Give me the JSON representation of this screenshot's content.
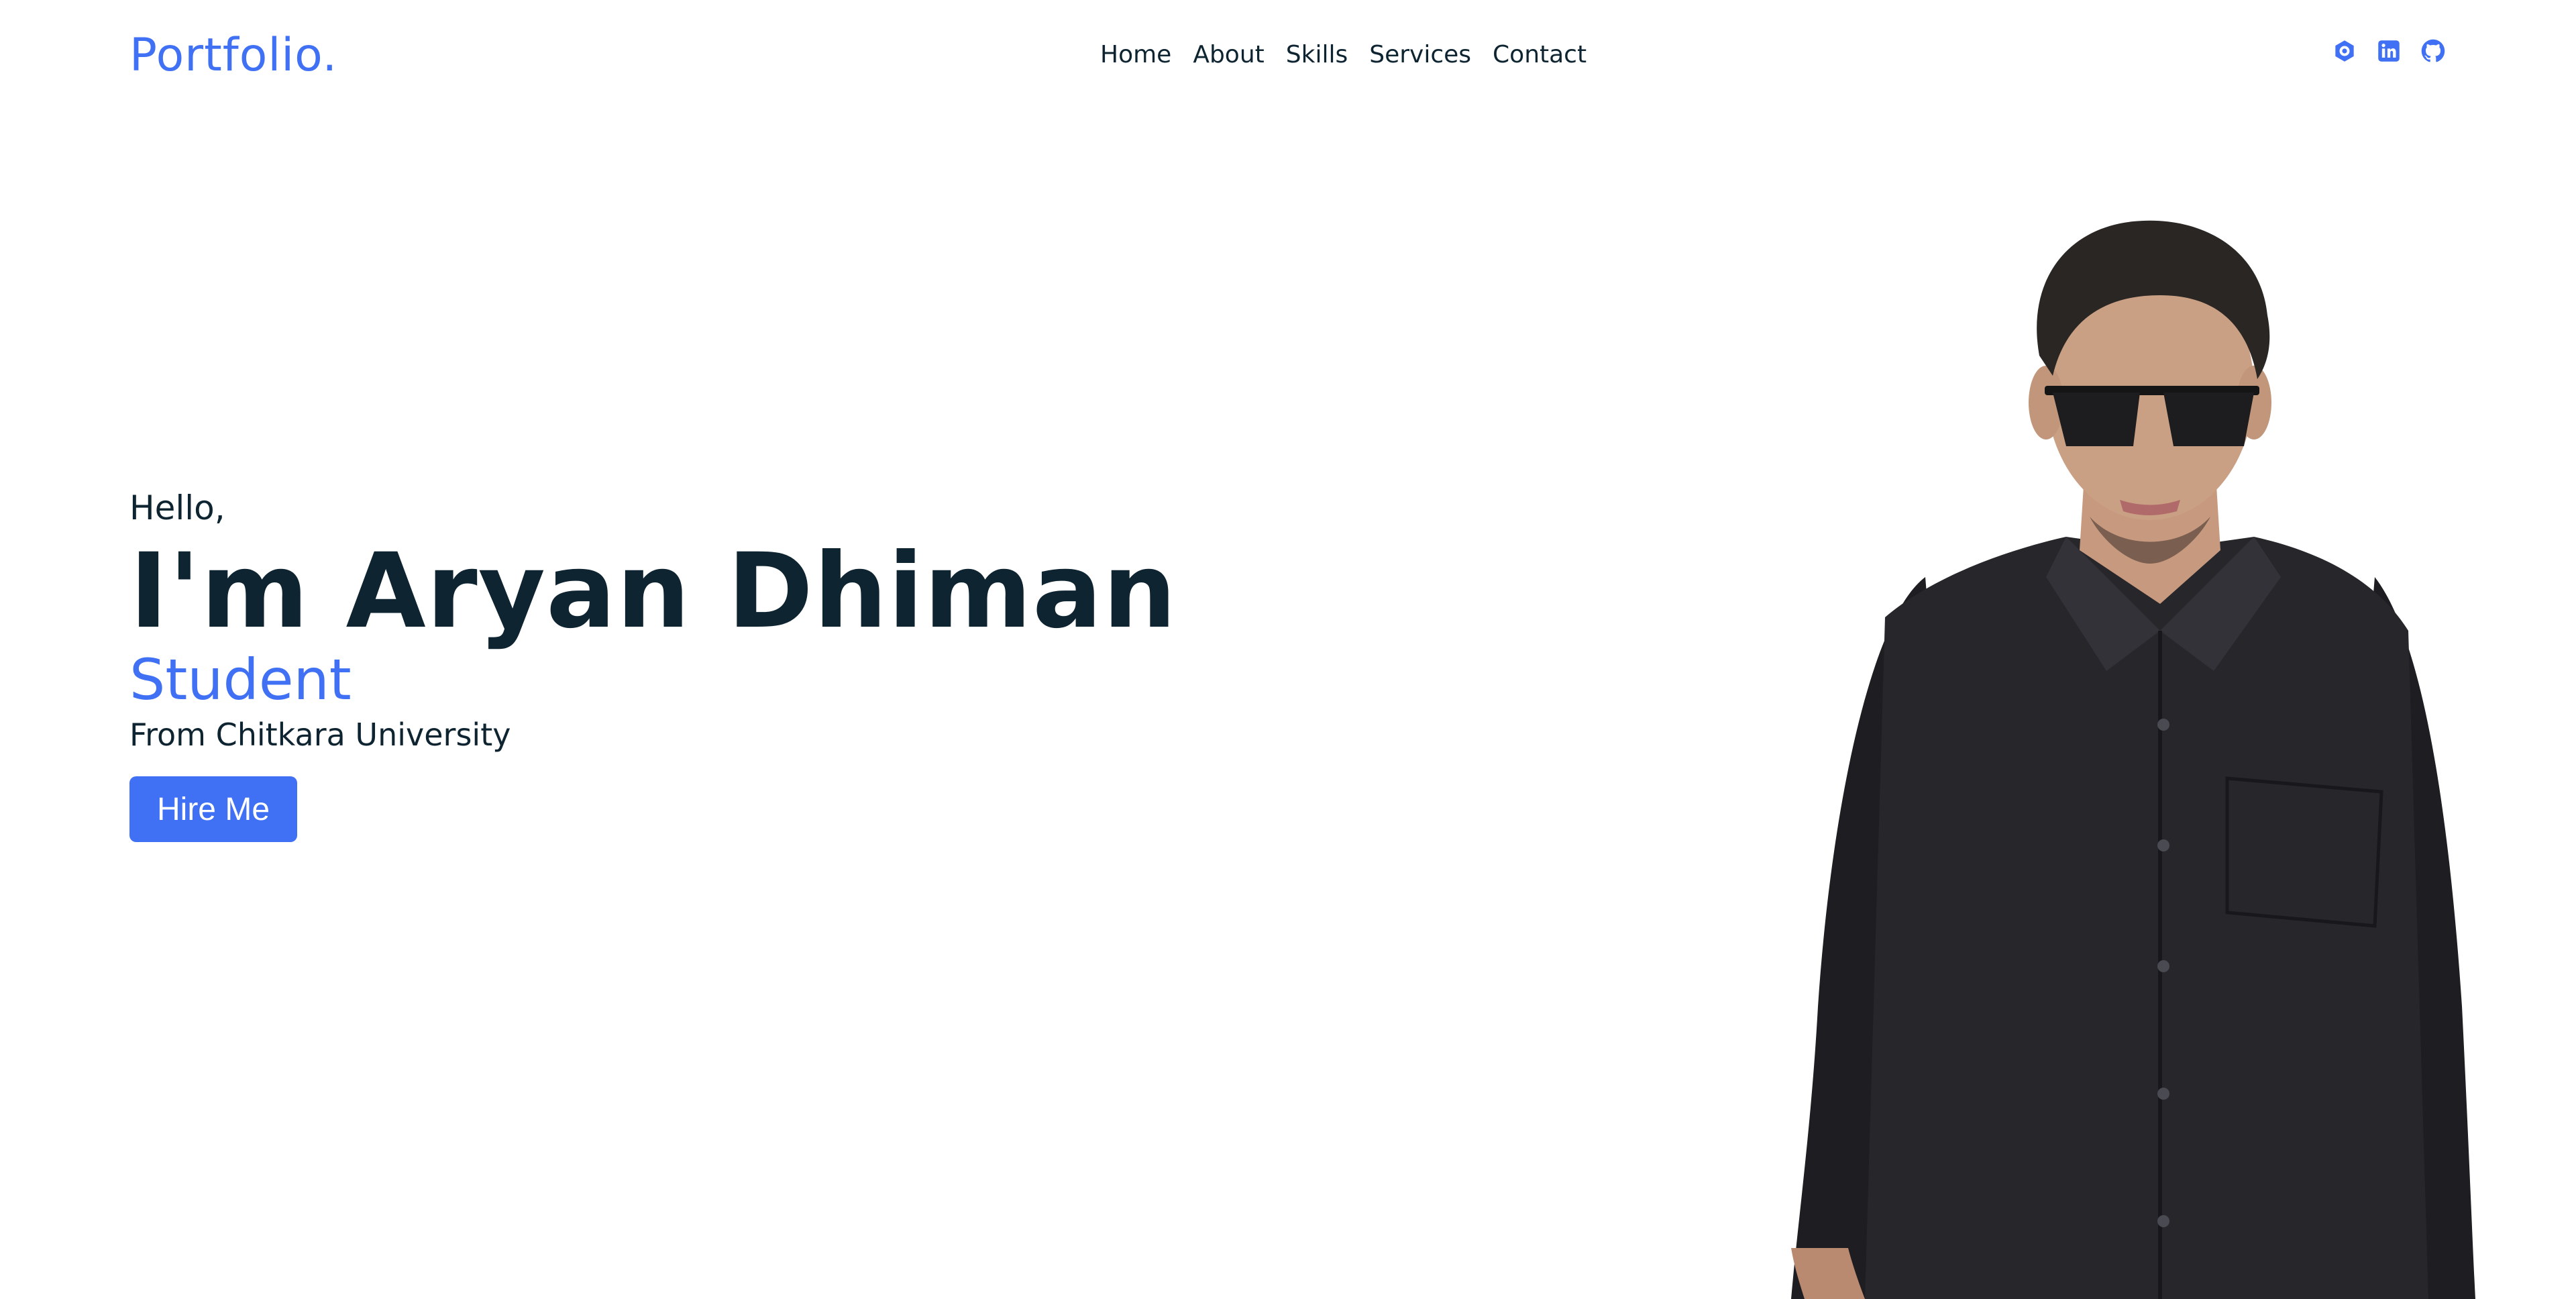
{
  "brand": {
    "logo": "Portfolio."
  },
  "nav": {
    "items": [
      {
        "label": "Home"
      },
      {
        "label": "About"
      },
      {
        "label": "Skills"
      },
      {
        "label": "Services"
      },
      {
        "label": "Contact"
      }
    ]
  },
  "socials": {
    "icons": [
      "hashnode-icon",
      "linkedin-icon",
      "github-icon"
    ]
  },
  "hero": {
    "greeting": "Hello,",
    "name": "I'm Aryan Dhiman",
    "role": "Student",
    "from": "From Chitkara University",
    "cta_label": "Hire Me"
  },
  "colors": {
    "accent": "#4070f4",
    "text": "#0e2431",
    "background": "#ffffff"
  }
}
